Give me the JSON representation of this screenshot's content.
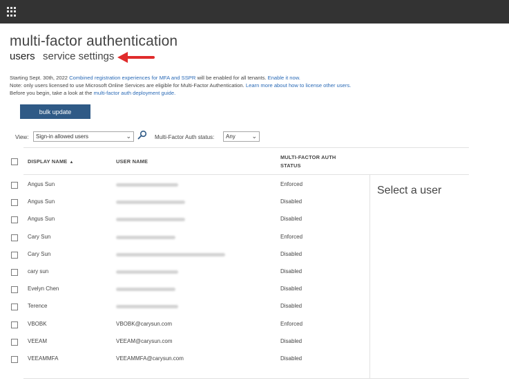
{
  "app": {
    "launcher_icon": "waffle-icon"
  },
  "header": {
    "title": "multi-factor authentication"
  },
  "tabs": {
    "users": "users",
    "service_settings": "service settings"
  },
  "colors": {
    "top_bar": "#333333",
    "button": "#2f5a86",
    "link": "#2a6ab6",
    "arrow": "#e02b2b"
  },
  "info": {
    "line1_prefix": "Starting Sept. 30th, 2022",
    "line1_link": "Combined registration experiences for MFA and SSPR",
    "line1_middle": "will be enabled for all tenants.",
    "line1_link2": "Enable it now.",
    "line2_text": "Note: only users licensed to use Microsoft Online Services are eligible for Multi-Factor Authentication.",
    "line2_link": "Learn more about how to license other users.",
    "line3_text": "Before you begin, take a look at the",
    "line3_link": "multi-factor auth deployment guide."
  },
  "toolbar": {
    "bulk_update": "bulk update"
  },
  "filters": {
    "view_label": "View:",
    "view_value": "Sign-in allowed users",
    "mfa_label": "Multi-Factor Auth status:",
    "mfa_value": "Any"
  },
  "table": {
    "headers": {
      "display_name": "DISPLAY NAME",
      "user_name": "USER NAME",
      "mfa_status_line1": "MULTI-FACTOR AUTH",
      "mfa_status_line2": "STATUS"
    },
    "rows": [
      {
        "display_name": "Angus Sun",
        "user_name": "",
        "status": "Enforced"
      },
      {
        "display_name": "Angus Sun",
        "user_name": "",
        "status": "Disabled"
      },
      {
        "display_name": "Angus Sun",
        "user_name": "",
        "status": "Disabled"
      },
      {
        "display_name": "Cary Sun",
        "user_name": "",
        "status": "Enforced"
      },
      {
        "display_name": "Cary Sun",
        "user_name": "",
        "status": "Disabled"
      },
      {
        "display_name": "cary sun",
        "user_name": "",
        "status": "Disabled"
      },
      {
        "display_name": "Evelyn Chen",
        "user_name": "",
        "status": "Disabled"
      },
      {
        "display_name": "Terence",
        "user_name": "",
        "status": "Disabled"
      },
      {
        "display_name": "VBOBK",
        "user_name": "VBOBK@carysun.com",
        "status": "Enforced"
      },
      {
        "display_name": "VEEAM",
        "user_name": "VEEAM@carysun.com",
        "status": "Disabled"
      },
      {
        "display_name": "VEEAMMFA",
        "user_name": "VEEAMMFA@carysun.com",
        "status": "Disabled"
      }
    ]
  },
  "detail": {
    "placeholder": "Select a user"
  }
}
